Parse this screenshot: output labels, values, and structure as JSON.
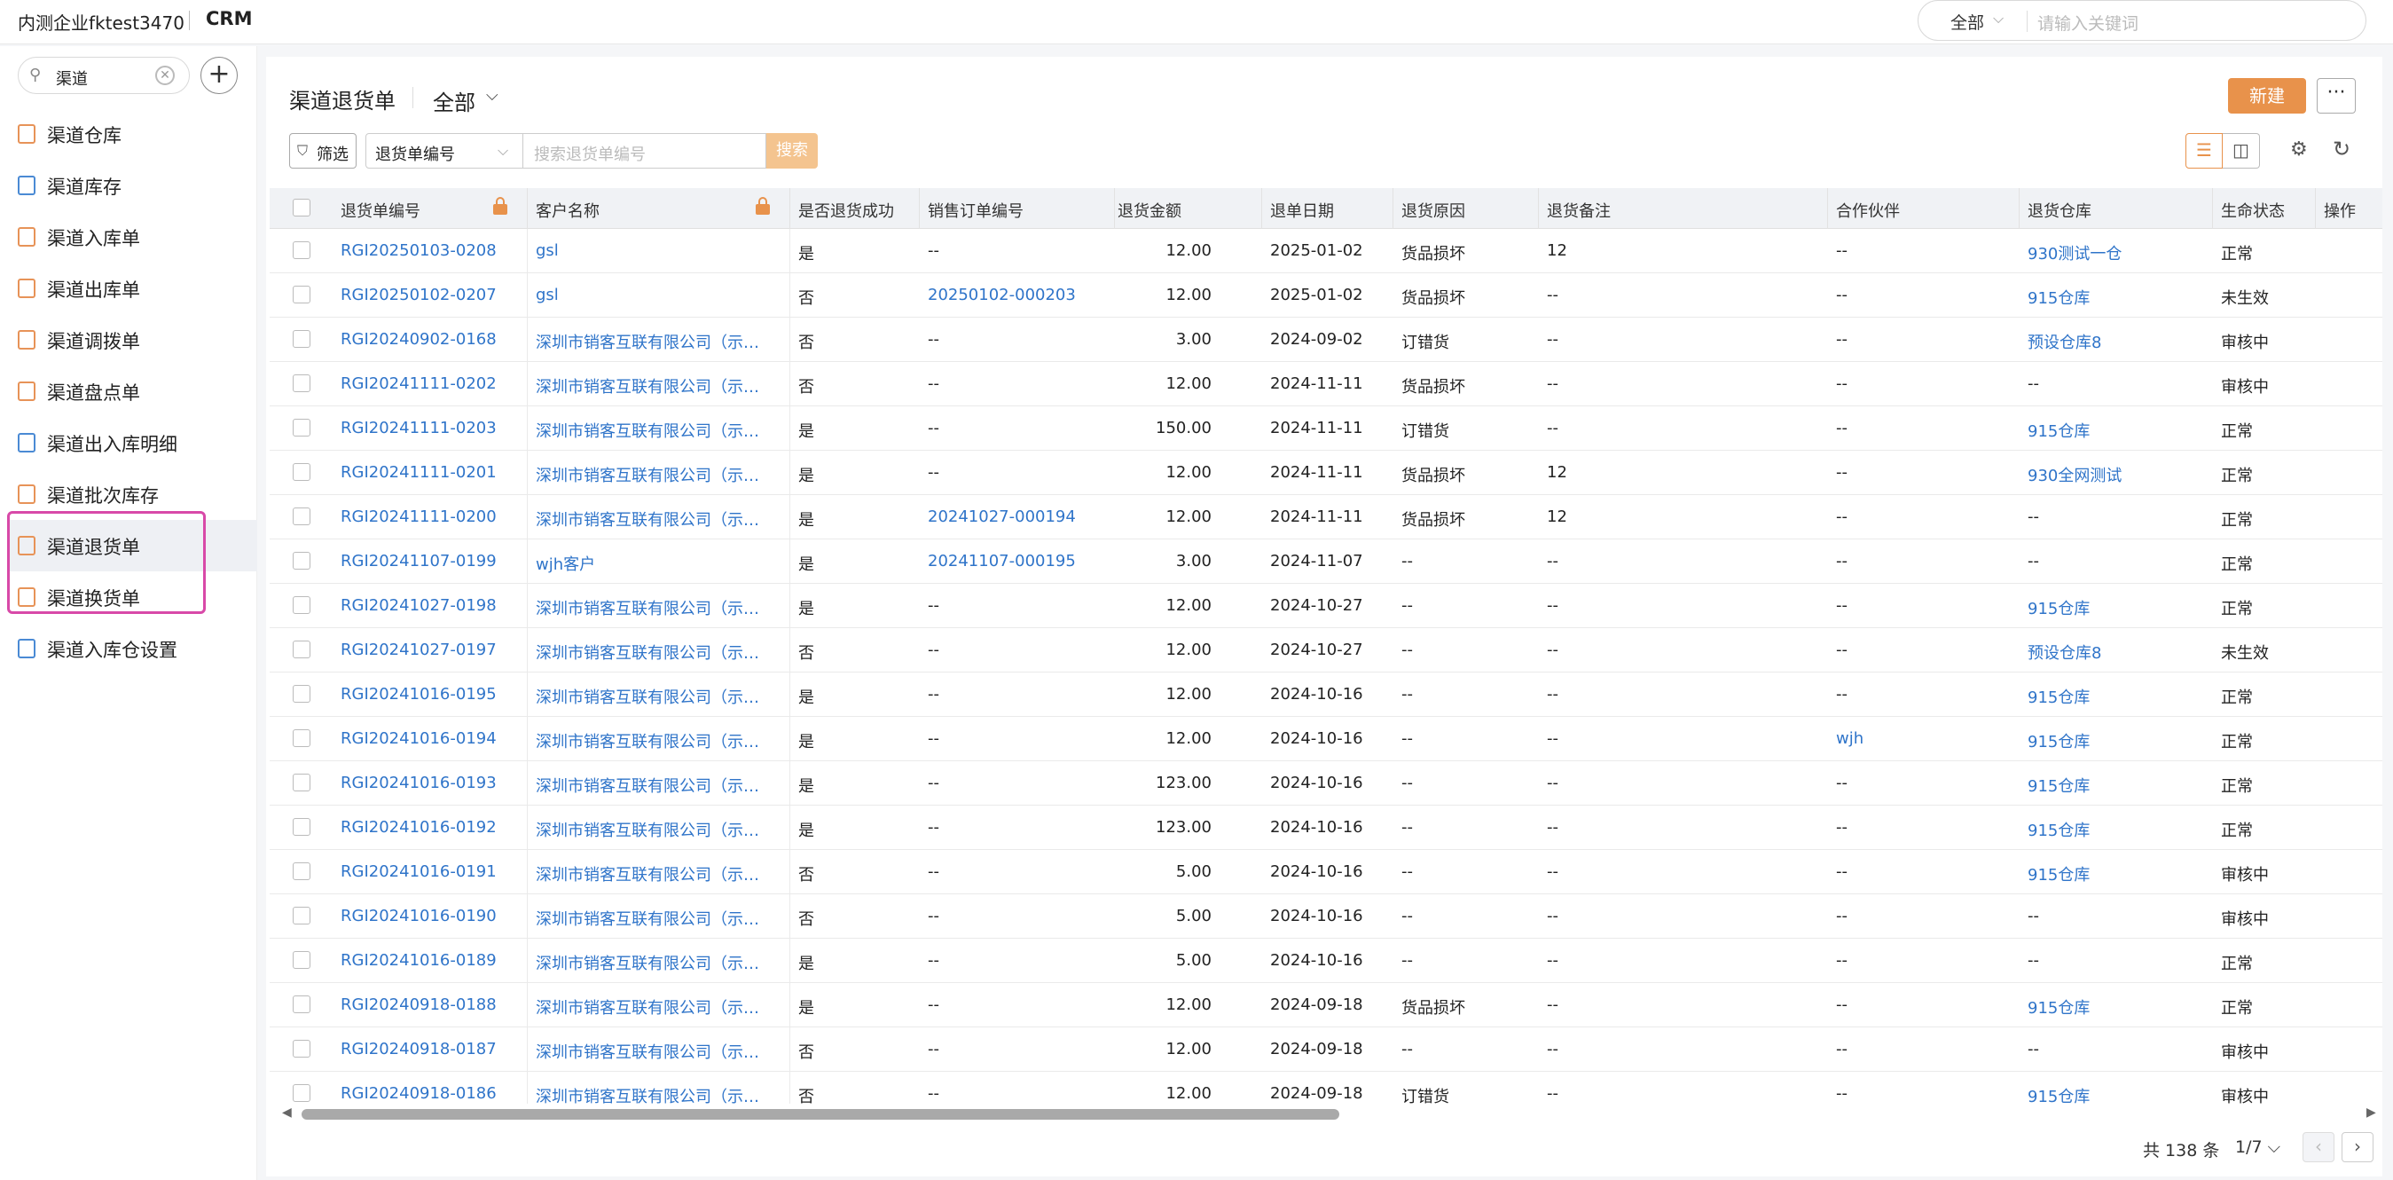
{
  "topbar": {
    "company": "内测企业fktest3470",
    "app": "CRM"
  },
  "global_search": {
    "scope": "全部",
    "placeholder": "请输入关键词"
  },
  "sidebar": {
    "search_value": "渠道",
    "items": [
      {
        "label": "渠道仓库",
        "icon": "warehouse-icon"
      },
      {
        "label": "渠道库存",
        "icon": "inventory-icon"
      },
      {
        "label": "渠道入库单",
        "icon": "inbound-doc-icon"
      },
      {
        "label": "渠道出库单",
        "icon": "outbound-icon"
      },
      {
        "label": "渠道调拨单",
        "icon": "transfer-icon"
      },
      {
        "label": "渠道盘点单",
        "icon": "stocktake-icon"
      },
      {
        "label": "渠道出入库明细",
        "icon": "io-detail-icon"
      },
      {
        "label": "渠道批次库存",
        "icon": "batch-inventory-icon"
      },
      {
        "label": "渠道退货单",
        "icon": "return-doc-icon"
      },
      {
        "label": "渠道换货单",
        "icon": "exchange-doc-icon"
      },
      {
        "label": "渠道入库仓设置",
        "icon": "warehouse-setting-icon"
      }
    ]
  },
  "page": {
    "title": "渠道退货单",
    "view": "全部",
    "new_label": "新建",
    "more_label": "···",
    "filter_label": "筛选",
    "search_field": "退货单编号",
    "search_placeholder": "搜索退货单编号",
    "search_button": "搜索"
  },
  "table": {
    "headers": [
      "退货单编号",
      "客户名称",
      "是否退货成功",
      "销售订单编号",
      "退货金额",
      "退单日期",
      "退货原因",
      "退货备注",
      "合作伙伴",
      "退货仓库",
      "生命状态",
      "操作"
    ],
    "rows": [
      [
        "RGI20250103-0208",
        "gsl",
        "是",
        "--",
        "12.00",
        "2025-01-02",
        "货品损坏",
        "12",
        "--",
        "930测试一仓",
        "正常"
      ],
      [
        "RGI20250102-0207",
        "gsl",
        "否",
        "20250102-000203",
        "12.00",
        "2025-01-02",
        "货品损坏",
        "--",
        "--",
        "915仓库",
        "未生效"
      ],
      [
        "RGI20240902-0168",
        "深圳市销客互联有限公司（示例数据）",
        "否",
        "--",
        "3.00",
        "2024-09-02",
        "订错货",
        "--",
        "--",
        "预设仓库8",
        "审核中"
      ],
      [
        "RGI20241111-0202",
        "深圳市销客互联有限公司（示例数据）",
        "否",
        "--",
        "12.00",
        "2024-11-11",
        "货品损坏",
        "--",
        "--",
        "--",
        "审核中"
      ],
      [
        "RGI20241111-0203",
        "深圳市销客互联有限公司（示例数据）",
        "是",
        "--",
        "150.00",
        "2024-11-11",
        "订错货",
        "--",
        "--",
        "915仓库",
        "正常"
      ],
      [
        "RGI20241111-0201",
        "深圳市销客互联有限公司（示例数据）",
        "是",
        "--",
        "12.00",
        "2024-11-11",
        "货品损坏",
        "12",
        "--",
        "930全网测试",
        "正常"
      ],
      [
        "RGI20241111-0200",
        "深圳市销客互联有限公司（示例数据）",
        "是",
        "20241027-000194",
        "12.00",
        "2024-11-11",
        "货品损坏",
        "12",
        "--",
        "--",
        "正常"
      ],
      [
        "RGI20241107-0199",
        "wjh客户",
        "是",
        "20241107-000195",
        "3.00",
        "2024-11-07",
        "--",
        "--",
        "--",
        "--",
        "正常"
      ],
      [
        "RGI20241027-0198",
        "深圳市销客互联有限公司（示例数据）",
        "是",
        "--",
        "12.00",
        "2024-10-27",
        "--",
        "--",
        "--",
        "915仓库",
        "正常"
      ],
      [
        "RGI20241027-0197",
        "深圳市销客互联有限公司（示例数据）",
        "否",
        "--",
        "12.00",
        "2024-10-27",
        "--",
        "--",
        "--",
        "预设仓库8",
        "未生效"
      ],
      [
        "RGI20241016-0195",
        "深圳市销客互联有限公司（示例数据）",
        "是",
        "--",
        "12.00",
        "2024-10-16",
        "--",
        "--",
        "--",
        "915仓库",
        "正常"
      ],
      [
        "RGI20241016-0194",
        "深圳市销客互联有限公司（示例数据）",
        "是",
        "--",
        "12.00",
        "2024-10-16",
        "--",
        "--",
        "wjh",
        "915仓库",
        "正常"
      ],
      [
        "RGI20241016-0193",
        "深圳市销客互联有限公司（示例数据）",
        "是",
        "--",
        "123.00",
        "2024-10-16",
        "--",
        "--",
        "--",
        "915仓库",
        "正常"
      ],
      [
        "RGI20241016-0192",
        "深圳市销客互联有限公司（示例数据）",
        "是",
        "--",
        "123.00",
        "2024-10-16",
        "--",
        "--",
        "--",
        "915仓库",
        "正常"
      ],
      [
        "RGI20241016-0191",
        "深圳市销客互联有限公司（示例数据）",
        "否",
        "--",
        "5.00",
        "2024-10-16",
        "--",
        "--",
        "--",
        "915仓库",
        "审核中"
      ],
      [
        "RGI20241016-0190",
        "深圳市销客互联有限公司（示例数据）",
        "否",
        "--",
        "5.00",
        "2024-10-16",
        "--",
        "--",
        "--",
        "--",
        "审核中"
      ],
      [
        "RGI20241016-0189",
        "深圳市销客互联有限公司（示例数据）",
        "是",
        "--",
        "5.00",
        "2024-10-16",
        "--",
        "--",
        "--",
        "--",
        "正常"
      ],
      [
        "RGI20240918-0188",
        "深圳市销客互联有限公司（示例数据）",
        "是",
        "--",
        "12.00",
        "2024-09-18",
        "货品损坏",
        "--",
        "--",
        "915仓库",
        "正常"
      ],
      [
        "RGI20240918-0187",
        "深圳市销客互联有限公司（示例数据）",
        "否",
        "--",
        "12.00",
        "2024-09-18",
        "--",
        "--",
        "--",
        "--",
        "审核中"
      ],
      [
        "RGI20240918-0186",
        "深圳市销客互联有限公司（示例数据）",
        "否",
        "--",
        "12.00",
        "2024-09-18",
        "订错货",
        "--",
        "--",
        "915仓库",
        "审核中"
      ]
    ]
  },
  "pager": {
    "total": "共 138 条",
    "page": "1/7"
  },
  "colors": {
    "accent": "#e8924b",
    "link": "#2f74c9",
    "highlight": "#d849a8"
  }
}
